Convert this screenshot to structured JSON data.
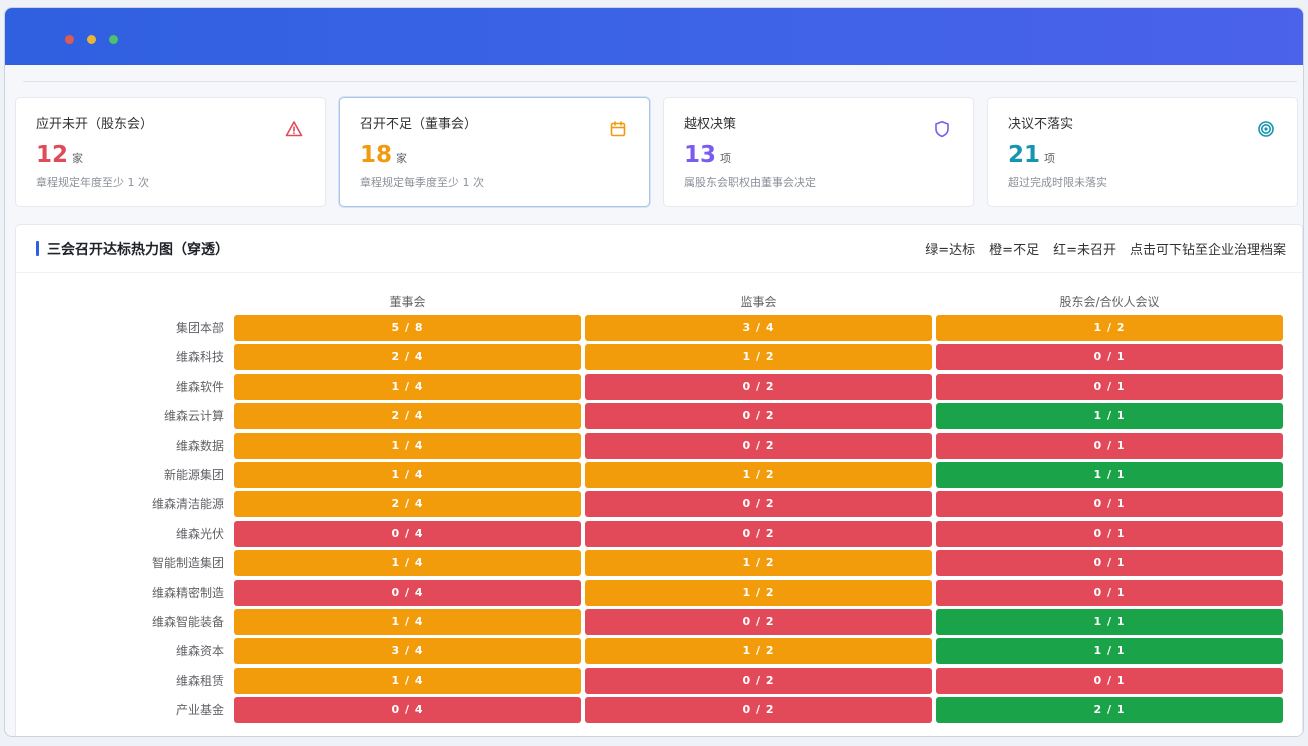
{
  "cards": [
    {
      "title": "应开未开（股东会）",
      "value": "12",
      "unit": "家",
      "desc": "章程规定年度至少 1 次",
      "color": "#e04b5a",
      "icon": "warning-icon"
    },
    {
      "title": "召开不足（董事会）",
      "value": "18",
      "unit": "家",
      "desc": "章程规定每季度至少 1 次",
      "color": "#f29a0e",
      "icon": "calendar-icon"
    },
    {
      "title": "越权决策",
      "value": "13",
      "unit": "项",
      "desc": "属股东会职权由董事会决定",
      "color": "#7b5cf0",
      "icon": "shield-icon"
    },
    {
      "title": "决议不落实",
      "value": "21",
      "unit": "项",
      "desc": "超过完成时限未落实",
      "color": "#1595b0",
      "icon": "target-icon"
    }
  ],
  "panel": {
    "title": "三会召开达标热力图（穿透）",
    "legend": [
      "绿=达标",
      "橙=不足",
      "红=未召开",
      "点击可下钻至企业治理档案"
    ]
  },
  "colors": {
    "green": "#1ba349",
    "orange": "#f39c0b",
    "red": "#e24a59"
  },
  "heatmap": {
    "columns": [
      "董事会",
      "监事会",
      "股东会/合伙人会议"
    ],
    "rows": [
      {
        "name": "集团本部",
        "cells": [
          {
            "v": "5 / 8",
            "s": "orange"
          },
          {
            "v": "3 / 4",
            "s": "orange"
          },
          {
            "v": "1 / 2",
            "s": "orange"
          }
        ]
      },
      {
        "name": "维森科技",
        "cells": [
          {
            "v": "2 / 4",
            "s": "orange"
          },
          {
            "v": "1 / 2",
            "s": "orange"
          },
          {
            "v": "0 / 1",
            "s": "red"
          }
        ]
      },
      {
        "name": "维森软件",
        "cells": [
          {
            "v": "1 / 4",
            "s": "orange"
          },
          {
            "v": "0 / 2",
            "s": "red"
          },
          {
            "v": "0 / 1",
            "s": "red"
          }
        ]
      },
      {
        "name": "维森云计算",
        "cells": [
          {
            "v": "2 / 4",
            "s": "orange"
          },
          {
            "v": "0 / 2",
            "s": "red"
          },
          {
            "v": "1 / 1",
            "s": "green"
          }
        ]
      },
      {
        "name": "维森数据",
        "cells": [
          {
            "v": "1 / 4",
            "s": "orange"
          },
          {
            "v": "0 / 2",
            "s": "red"
          },
          {
            "v": "0 / 1",
            "s": "red"
          }
        ]
      },
      {
        "name": "新能源集团",
        "cells": [
          {
            "v": "1 / 4",
            "s": "orange"
          },
          {
            "v": "1 / 2",
            "s": "orange"
          },
          {
            "v": "1 / 1",
            "s": "green"
          }
        ]
      },
      {
        "name": "维森清洁能源",
        "cells": [
          {
            "v": "2 / 4",
            "s": "orange"
          },
          {
            "v": "0 / 2",
            "s": "red"
          },
          {
            "v": "0 / 1",
            "s": "red"
          }
        ]
      },
      {
        "name": "维森光伏",
        "cells": [
          {
            "v": "0 / 4",
            "s": "red"
          },
          {
            "v": "0 / 2",
            "s": "red"
          },
          {
            "v": "0 / 1",
            "s": "red"
          }
        ]
      },
      {
        "name": "智能制造集团",
        "cells": [
          {
            "v": "1 / 4",
            "s": "orange"
          },
          {
            "v": "1 / 2",
            "s": "orange"
          },
          {
            "v": "0 / 1",
            "s": "red"
          }
        ]
      },
      {
        "name": "维森精密制造",
        "cells": [
          {
            "v": "0 / 4",
            "s": "red"
          },
          {
            "v": "1 / 2",
            "s": "orange"
          },
          {
            "v": "0 / 1",
            "s": "red"
          }
        ]
      },
      {
        "name": "维森智能装备",
        "cells": [
          {
            "v": "1 / 4",
            "s": "orange"
          },
          {
            "v": "0 / 2",
            "s": "red"
          },
          {
            "v": "1 / 1",
            "s": "green"
          }
        ]
      },
      {
        "name": "维森资本",
        "cells": [
          {
            "v": "3 / 4",
            "s": "orange"
          },
          {
            "v": "1 / 2",
            "s": "orange"
          },
          {
            "v": "1 / 1",
            "s": "green"
          }
        ]
      },
      {
        "name": "维森租赁",
        "cells": [
          {
            "v": "1 / 4",
            "s": "orange"
          },
          {
            "v": "0 / 2",
            "s": "red"
          },
          {
            "v": "0 / 1",
            "s": "red"
          }
        ]
      },
      {
        "name": "产业基金",
        "cells": [
          {
            "v": "0 / 4",
            "s": "red"
          },
          {
            "v": "0 / 2",
            "s": "red"
          },
          {
            "v": "2 / 1",
            "s": "green"
          }
        ]
      }
    ]
  }
}
